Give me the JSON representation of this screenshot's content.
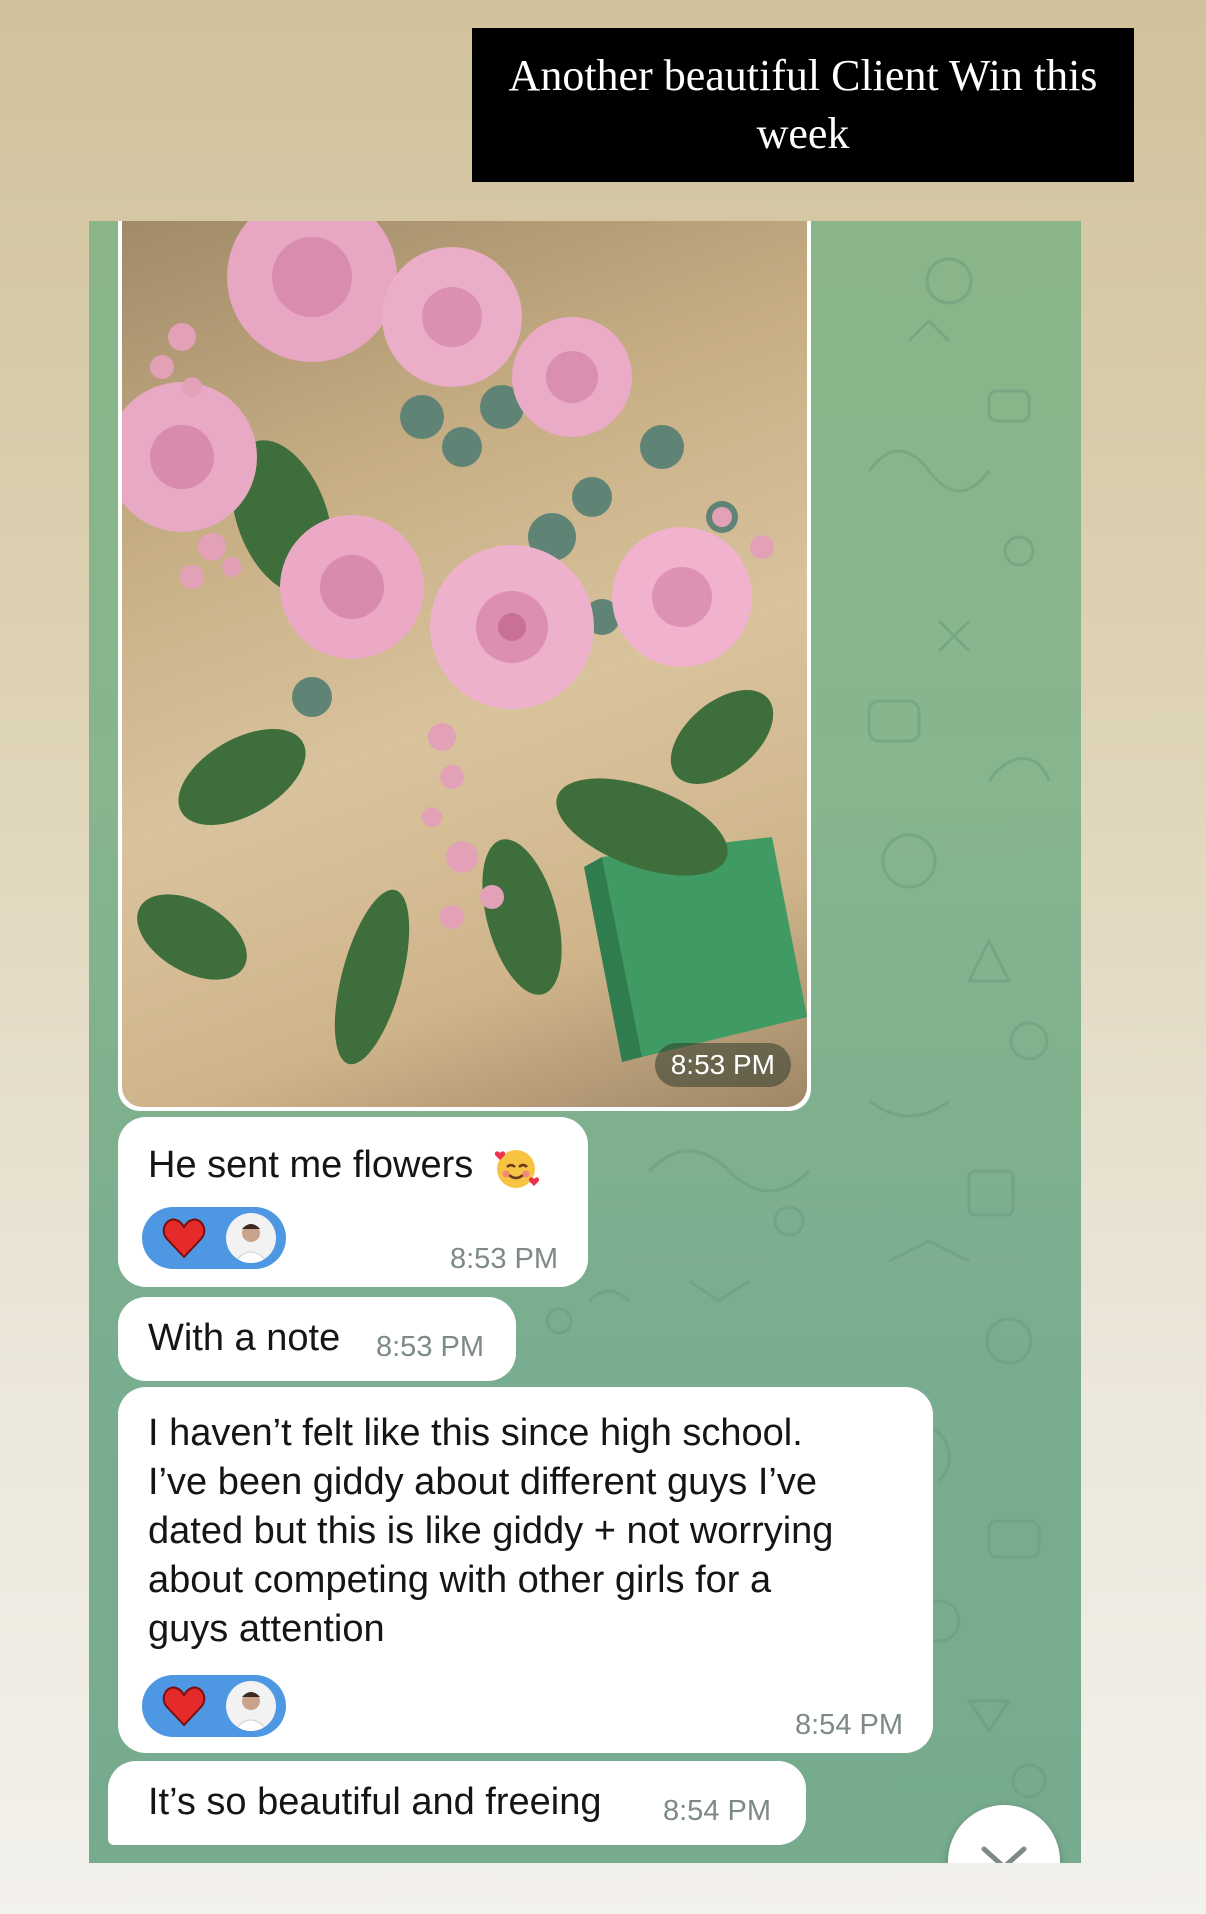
{
  "caption": "Another beautiful Client Win this week",
  "messages": [
    {
      "type": "photo",
      "time": "8:53 PM",
      "alt": "Bouquet of pink roses with eucalyptus and a green note card"
    },
    {
      "type": "text",
      "text": "He sent me flowers",
      "emoji": "smiling-face-with-hearts",
      "reaction": "heart",
      "time": "8:53 PM"
    },
    {
      "type": "text",
      "text": "With a note",
      "time": "8:53 PM"
    },
    {
      "type": "text",
      "lines": [
        "I haven’t felt like this since high school.",
        "I’ve been giddy about different guys I’ve",
        "dated but this is like giddy + not worrying",
        "about competing with other girls for a",
        "guys attention"
      ],
      "reaction": "heart",
      "time": "8:54 PM"
    },
    {
      "type": "text",
      "text": "It’s so beautiful and freeing",
      "time": "8:54 PM"
    }
  ],
  "colors": {
    "chat_bg": "#80b28d",
    "reaction_bg": "#4e97e2",
    "heart": "#e42a2a",
    "caption_bg": "#000000"
  }
}
